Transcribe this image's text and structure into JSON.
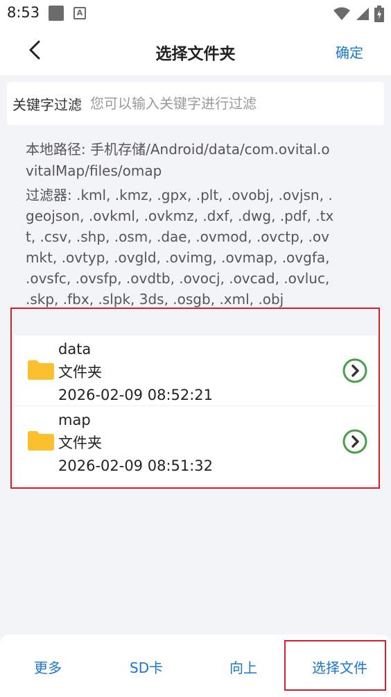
{
  "status_bar": {
    "time": "8:53",
    "notification_icons": [
      "square-icon",
      "a-app-icon"
    ],
    "system_icons": [
      "wifi-icon",
      "signal-icon",
      "battery-icon"
    ]
  },
  "header": {
    "title": "选择文件夹",
    "confirm_label": "确定",
    "back_icon": "chevron-left-icon"
  },
  "filter": {
    "label": "关键字过滤",
    "placeholder": "您可以输入关键字进行过滤"
  },
  "info": {
    "path": "本地路径: 手机存储/Android/data/com.ovital.ovitalMap/files/omap",
    "filters": "过滤器: .kml, .kmz, .gpx, .plt, .ovobj, .ovjsn, .geojson, .ovkml, .ovkmz, .dxf, .dwg, .pdf, .txt, .csv, .shp, .osm, .dae, .ovmod, .ovctp, .ovmkt, .ovtyp, .ovgld, .ovimg, .ovmap, .ovgfa, .ovsfc, .ovsfp, .ovdtb, .ovocj, .ovcad, .ovluc, .skp, .fbx, .slpk, 3ds, .osgb, .xml, .obj"
  },
  "entries": [
    {
      "name": "data",
      "type": "文件夹",
      "modified": "2026-02-09 08:52:21"
    },
    {
      "name": "map",
      "type": "文件夹",
      "modified": "2026-02-09 08:51:32"
    }
  ],
  "bottom_bar": {
    "more_label": "更多",
    "sd_label": "SD卡",
    "up_label": "向上",
    "select_file_label": "选择文件"
  },
  "colors": {
    "accent": "#1976d2",
    "folder": "#fbc02d",
    "arrow": "#43a047",
    "highlight": "#d81e28"
  }
}
